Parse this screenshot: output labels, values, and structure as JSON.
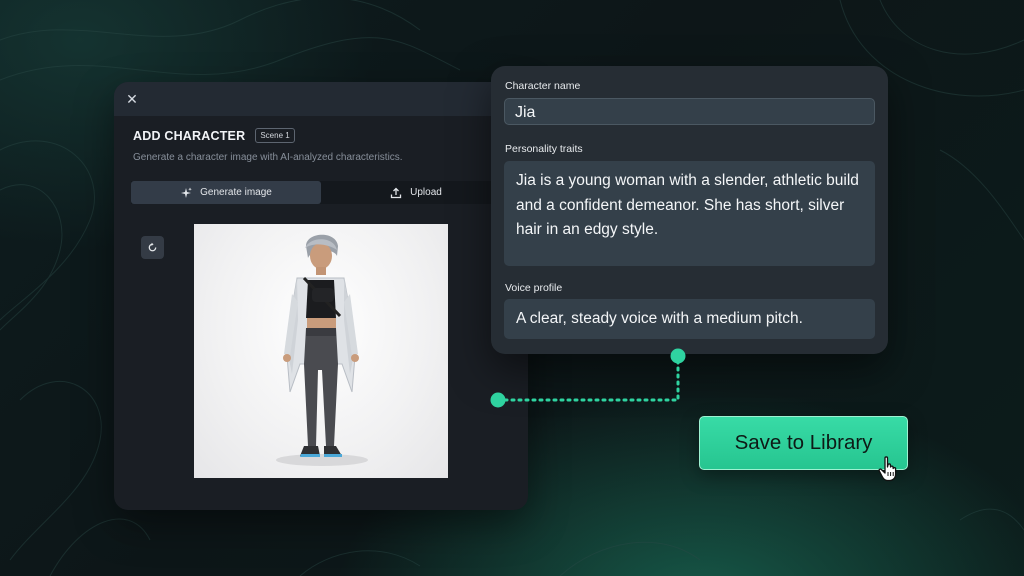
{
  "modal": {
    "close_icon": "close-icon",
    "title": "ADD CHARACTER",
    "scene_badge": "Scene 1",
    "subtitle": "Generate a character image with AI-analyzed characteristics.",
    "tabs": [
      {
        "label": "Generate image",
        "icon": "sparkle-icon",
        "active": true
      },
      {
        "label": "Upload",
        "icon": "upload-icon",
        "active": false
      }
    ],
    "refresh_icon": "refresh-icon"
  },
  "character": {
    "name_label": "Character name",
    "name_value": "Jia",
    "traits_label": "Personality traits",
    "traits_value": "Jia is a young woman with a slender, athletic build and a confident demeanor. She has short, silver hair in an edgy style.",
    "voice_label": "Voice profile",
    "voice_value": "A clear, steady voice with a medium pitch."
  },
  "save_button": {
    "label": "Save to Library"
  },
  "colors": {
    "accent": "#2fd3a0",
    "background": "#0d1a1c",
    "modal_bg": "#1a1e24",
    "panel_bg": "#262d34"
  }
}
